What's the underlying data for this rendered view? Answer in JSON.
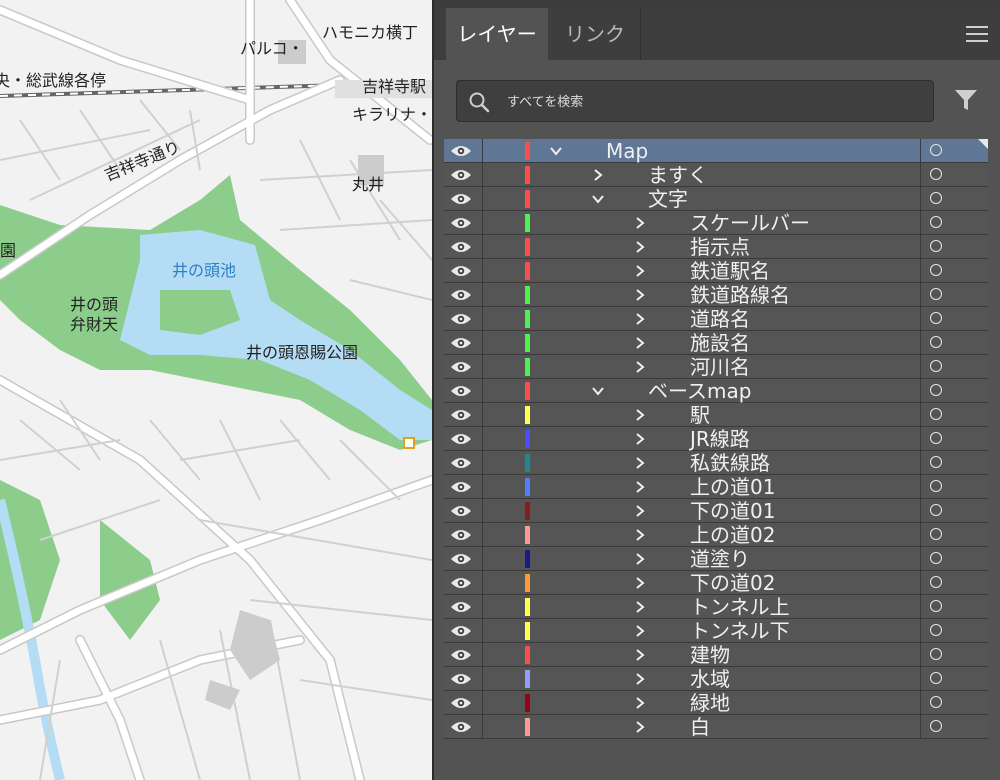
{
  "map": {
    "labels": {
      "harmonica": "ハモニカ横丁",
      "parco": "パルコ・",
      "sobu": "央・総武線各停",
      "kichijoji_station": "吉祥寺駅",
      "kirarina": "キラリナ・",
      "marui": "丸井",
      "kichijoji_dori": "吉祥寺通り",
      "park_cut": "園",
      "inokashira_pond": "井の頭池",
      "benzaiten_1": "井の頭",
      "benzaiten_2": "弁財天",
      "onshi_park": "井の頭恩賜公園"
    },
    "colors": {
      "land": "#f2f2f2",
      "park": "#8ccd8c",
      "water": "#b5dcf5",
      "road": "#ffffff",
      "road_edge": "#c8c8c8",
      "building": "#cccccc"
    }
  },
  "panel": {
    "tabs": [
      {
        "label": "レイヤー",
        "active": true
      },
      {
        "label": "リンク",
        "active": false
      }
    ],
    "search": {
      "placeholder": "すべてを検索"
    },
    "colors": {
      "bg": "#535353",
      "selected": "#5f7694"
    },
    "layers": [
      {
        "name": "Map",
        "level": 0,
        "expanded": true,
        "color": "#ff4d4d",
        "selected": true
      },
      {
        "name": "ますく",
        "level": 1,
        "expanded": false,
        "color": "#ff4d4d"
      },
      {
        "name": "文字",
        "level": 1,
        "expanded": true,
        "color": "#ff4d4d"
      },
      {
        "name": "スケールバー",
        "level": 2,
        "expanded": false,
        "color": "#4df24d"
      },
      {
        "name": "指示点",
        "level": 2,
        "expanded": false,
        "color": "#ff4d4d"
      },
      {
        "name": "鉄道駅名",
        "level": 2,
        "expanded": false,
        "color": "#ff4d4d"
      },
      {
        "name": "鉄道路線名",
        "level": 2,
        "expanded": false,
        "color": "#4df24d"
      },
      {
        "name": "道路名",
        "level": 2,
        "expanded": false,
        "color": "#4df24d"
      },
      {
        "name": "施設名",
        "level": 2,
        "expanded": false,
        "color": "#4df24d"
      },
      {
        "name": "河川名",
        "level": 2,
        "expanded": false,
        "color": "#4df24d"
      },
      {
        "name": "ベースmap",
        "level": 1,
        "expanded": true,
        "color": "#ff4d4d"
      },
      {
        "name": "駅",
        "level": 2,
        "expanded": false,
        "color": "#ffff4d"
      },
      {
        "name": "JR線路",
        "level": 2,
        "expanded": false,
        "color": "#4d4dff"
      },
      {
        "name": "私鉄線路",
        "level": 2,
        "expanded": false,
        "color": "#1a8c8c"
      },
      {
        "name": "上の道01",
        "level": 2,
        "expanded": false,
        "color": "#4d80ff"
      },
      {
        "name": "下の道01",
        "level": 2,
        "expanded": false,
        "color": "#8c1a1a"
      },
      {
        "name": "上の道02",
        "level": 2,
        "expanded": false,
        "color": "#ff9999"
      },
      {
        "name": "道塗り",
        "level": 2,
        "expanded": false,
        "color": "#1a1a8c"
      },
      {
        "name": "下の道02",
        "level": 2,
        "expanded": false,
        "color": "#ff9933"
      },
      {
        "name": "トンネル上",
        "level": 2,
        "expanded": false,
        "color": "#ffff4d"
      },
      {
        "name": "トンネル下",
        "level": 2,
        "expanded": false,
        "color": "#ffff4d"
      },
      {
        "name": "建物",
        "level": 2,
        "expanded": false,
        "color": "#ff4d4d"
      },
      {
        "name": "水域",
        "level": 2,
        "expanded": false,
        "color": "#9999ff"
      },
      {
        "name": "緑地",
        "level": 2,
        "expanded": false,
        "color": "#99001a"
      },
      {
        "name": "白",
        "level": 2,
        "expanded": false,
        "color": "#ff9999"
      }
    ]
  }
}
